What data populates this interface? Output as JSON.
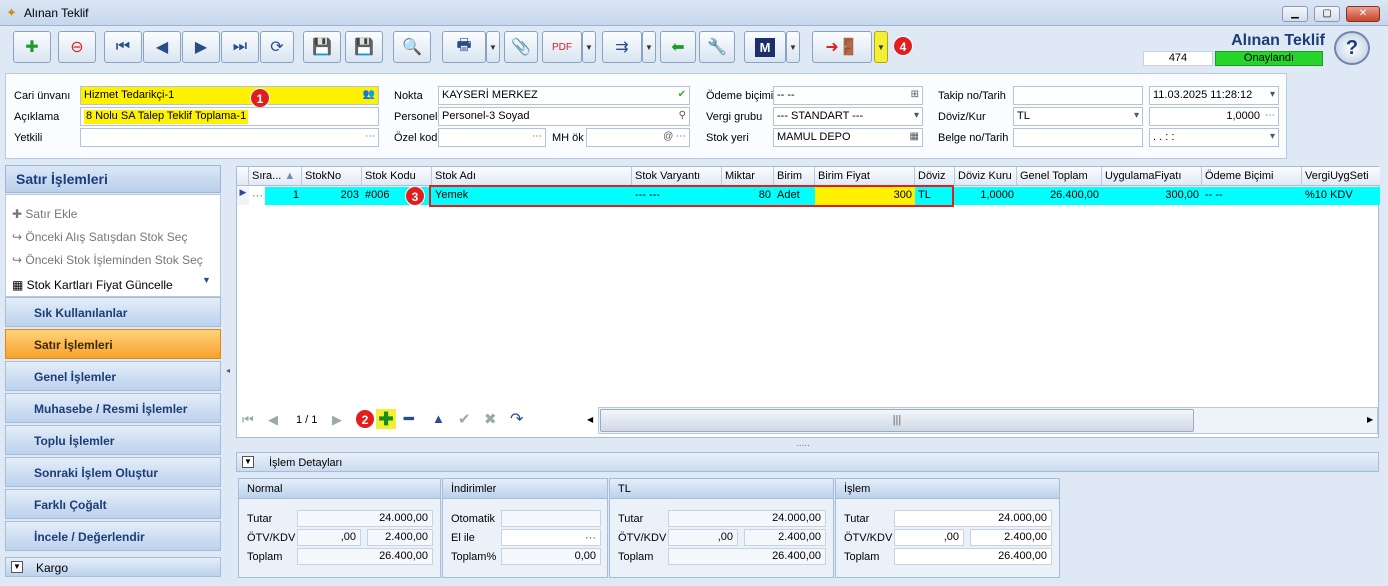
{
  "window": {
    "title": "Alınan Teklif",
    "min": "▁",
    "max": "▢",
    "close": "✕"
  },
  "header": {
    "title": "Alınan Teklif",
    "number": "474",
    "status": "Onaylandı",
    "help": "?"
  },
  "badges": [
    "1",
    "2",
    "3",
    "4"
  ],
  "form": {
    "cari_unvani_label": "Cari ünvanı",
    "cari_unvani": "Hizmet Tedarikçi-1",
    "aciklama_label": "Açıklama",
    "aciklama": "8 Nolu SA Talep Teklif Toplama-1",
    "yetkili_label": "Yetkili",
    "yetkili": "",
    "nokta_label": "Nokta",
    "nokta": "KAYSERİ MERKEZ",
    "personel_label": "Personel",
    "personel": "Personel-3 Soyad",
    "ozel_kod_label": "Özel kod",
    "ozel_kod": "",
    "mh_ok_label": "MH ök",
    "mh_ok": "",
    "odeme_bicimi_label": "Ödeme biçimi",
    "odeme_bicimi": "-- --",
    "vergi_grubu_label": "Vergi grubu",
    "vergi_grubu": "--- STANDART ---",
    "stok_yeri_label": "Stok yeri",
    "stok_yeri": "MAMUL DEPO",
    "takip_label": "Takip no/Tarih",
    "takip_no": "",
    "tarih": "11.03.2025 11:28:12",
    "doviz_label": "Döviz/Kur",
    "doviz": "TL",
    "kur": "1,0000",
    "belge_label": "Belge no/Tarih",
    "belge_no": "",
    "belge_tarih": ".  .       :  :"
  },
  "left": {
    "header": "Satır İşlemleri",
    "items": [
      "Satır Ekle",
      "Önceki Alış Satışdan Stok Seç",
      "Önceki Stok İşleminden Stok Seç",
      "Stok Kartları Fiyat Güncelle"
    ],
    "nav": [
      "Sık Kullanılanlar",
      "Satır İşlemleri",
      "Genel İşlemler",
      "Muhasebe / Resmi İşlemler",
      "Toplu İşlemler",
      "Sonraki İşlem Oluştur",
      "Farklı Çoğalt",
      "İncele / Değerlendir",
      "Kargo"
    ]
  },
  "grid": {
    "columns": [
      "Sıra...",
      "StokNo",
      "Stok Kodu",
      "Stok Adı",
      "Stok Varyantı",
      "Miktar",
      "Birim",
      "Birim Fiyat",
      "Döviz",
      "Döviz Kuru",
      "Genel Toplam",
      "UygulamaFiyatı",
      "Ödeme Biçimi",
      "VergiUygSeti"
    ],
    "row": [
      "1",
      "203",
      "#006",
      "Yemek",
      "--- ---",
      "80",
      "Adet",
      "300",
      "TL",
      "1,0000",
      "26.400,00",
      "300,00",
      "-- --",
      "%10 KDV"
    ],
    "pager": "1 / 1",
    "splitter": "....."
  },
  "details": {
    "title": "İşlem Detayları",
    "normal": {
      "title": "Normal",
      "tutar_label": "Tutar",
      "tutar": "24.000,00",
      "otv_label": "ÖTV/KDV",
      "otv": ",00",
      "kdv": "2.400,00",
      "toplam_label": "Toplam",
      "toplam": "26.400,00"
    },
    "indirim": {
      "title": "İndirimler",
      "otomatik_label": "Otomatik",
      "otomatik": "",
      "elile_label": "El ile",
      "elile": "",
      "toplam_label": "Toplam%",
      "toplam": "0,00"
    },
    "tl": {
      "title": "TL",
      "tutar_label": "Tutar",
      "tutar": "24.000,00",
      "otv_label": "ÖTV/KDV",
      "otv": ",00",
      "kdv": "2.400,00",
      "toplam_label": "Toplam",
      "toplam": "26.400,00"
    },
    "islem": {
      "title": "İşlem",
      "tutar_label": "Tutar",
      "tutar": "24.000,00",
      "otv_label": "ÖTV/KDV",
      "otv": ",00",
      "kdv": "2.400,00",
      "toplam_label": "Toplam",
      "toplam": "26.400,00"
    }
  },
  "colors": {
    "highlight_row": "#00ffff",
    "yellow_field": "#fff200",
    "status_green": "#26d42a",
    "badge_red": "#e21d1d"
  }
}
